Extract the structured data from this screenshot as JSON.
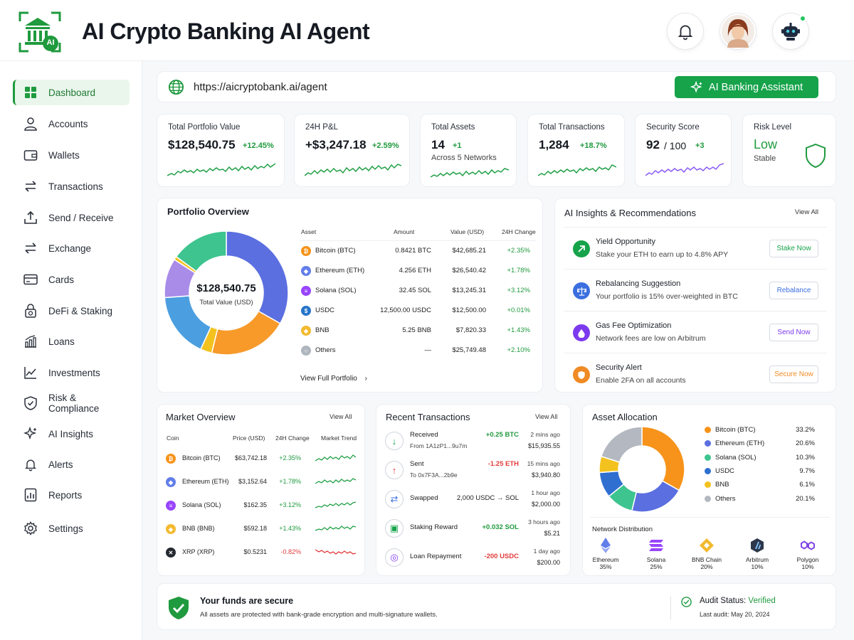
{
  "header": {
    "title": "AI Crypto Banking AI Agent",
    "logo_text": "AI",
    "bell_icon": "bell-icon",
    "avatar_icon": "user-avatar",
    "bot_icon": "robot-icon",
    "accent": "#16a34a"
  },
  "sidebar": {
    "items": [
      {
        "label": "Dashboard",
        "icon": "dashboard-icon",
        "active": true
      },
      {
        "label": "Accounts",
        "icon": "user-icon"
      },
      {
        "label": "Wallets",
        "icon": "wallet-icon"
      },
      {
        "label": "Transactions",
        "icon": "transfer-icon"
      },
      {
        "label": "Send / Receive",
        "icon": "upload-icon"
      },
      {
        "label": "Exchange",
        "icon": "exchange-icon"
      },
      {
        "label": "Cards",
        "icon": "card-icon"
      },
      {
        "label": "DeFi & Staking",
        "icon": "lock-coin-icon"
      },
      {
        "label": "Loans",
        "icon": "bar-chart-icon"
      },
      {
        "label": "Investments",
        "icon": "trend-icon"
      },
      {
        "label": "Risk & Compliance",
        "icon": "shield-icon"
      },
      {
        "label": "AI Insights",
        "icon": "sparkle-icon"
      },
      {
        "label": "Alerts",
        "icon": "bell-icon"
      },
      {
        "label": "Reports",
        "icon": "report-icon"
      },
      {
        "label": "Settings",
        "icon": "gear-icon"
      }
    ]
  },
  "urlbar": {
    "url": "https://aicryptobank.ai/agent",
    "assistant_label": "AI Banking Assistant"
  },
  "stats": {
    "portfolio": {
      "title": "Total Portfolio Value",
      "value": "$128,540.75",
      "change": "+12.45%"
    },
    "pnl": {
      "title": "24H P&L",
      "value": "+$3,247.18",
      "change": "+2.59%"
    },
    "assets": {
      "title": "Total Assets",
      "value": "14",
      "change": "+1",
      "sub": "Across 5 Networks"
    },
    "transactions": {
      "title": "Total Transactions",
      "value": "1,284",
      "change": "+18.7%"
    },
    "security": {
      "title": "Security Score",
      "value": "92",
      "outof": "/ 100",
      "change": "+3"
    },
    "risk": {
      "title": "Risk Level",
      "value": "Low",
      "sub": "Stable"
    }
  },
  "portfolio_overview": {
    "title": "Portfolio Overview",
    "center_value": "$128,540.75",
    "center_label": "Total Value (USD)",
    "headers": [
      "Asset",
      "Amount",
      "Value (USD)",
      "24H Change"
    ],
    "rows": [
      {
        "asset": "Bitcoin (BTC)",
        "amount": "0.8421 BTC",
        "value": "$42,685.21",
        "change": "+2.35%",
        "color": "#f7931a",
        "glyph": "₿"
      },
      {
        "asset": "Ethereum (ETH)",
        "amount": "4.256 ETH",
        "value": "$26,540.42",
        "change": "+1.78%",
        "color": "#627eea",
        "glyph": "◆"
      },
      {
        "asset": "Solana (SOL)",
        "amount": "32.45 SOL",
        "value": "$13,245.31",
        "change": "+3.12%",
        "color": "#9945ff",
        "glyph": "≡"
      },
      {
        "asset": "USDC",
        "amount": "12,500.00 USDC",
        "value": "$12,500.00",
        "change": "+0.01%",
        "color": "#2775ca",
        "glyph": "$"
      },
      {
        "asset": "BNB",
        "amount": "5.25 BNB",
        "value": "$7,820.33",
        "change": "+1.43%",
        "color": "#f3ba2f",
        "glyph": "◈"
      },
      {
        "asset": "Others",
        "amount": "—",
        "value": "$25,749.48",
        "change": "+2.10%",
        "color": "#b0b6bf",
        "glyph": "○"
      }
    ],
    "link": "View Full Portfolio"
  },
  "insights": {
    "title": "AI Insights & Recommendations",
    "view_all": "View All",
    "items": [
      {
        "title": "Yield Opportunity",
        "desc": "Stake your ETH to earn up to 4.8% APY",
        "button": "Stake Now",
        "color": "#16a34a",
        "icon": "trend-up-icon"
      },
      {
        "title": "Rebalancing Suggestion",
        "desc": "Your portfolio is 15% over-weighted in BTC",
        "button": "Rebalance",
        "color": "#3b6fe0",
        "icon": "scale-icon"
      },
      {
        "title": "Gas Fee Optimization",
        "desc": "Network fees are low on Arbitrum",
        "button": "Send Now",
        "color": "#7c3aed",
        "icon": "gas-icon"
      },
      {
        "title": "Security Alert",
        "desc": "Enable 2FA on all accounts",
        "button": "Secure Now",
        "color": "#f08a24",
        "icon": "shield-alert-icon"
      }
    ]
  },
  "market": {
    "title": "Market Overview",
    "view_all": "View All",
    "headers": [
      "Coin",
      "Price (USD)",
      "24H Change",
      "Market Trend"
    ],
    "rows": [
      {
        "coin": "Bitcoin (BTC)",
        "price": "$63,742.18",
        "change": "+2.35%",
        "color": "#f7931a",
        "glyph": "₿"
      },
      {
        "coin": "Ethereum (ETH)",
        "price": "$3,152.64",
        "change": "+1.78%",
        "color": "#627eea",
        "glyph": "◆"
      },
      {
        "coin": "Solana (SOL)",
        "price": "$162.35",
        "change": "+3.12%",
        "color": "#9945ff",
        "glyph": "≡"
      },
      {
        "coin": "BNB (BNB)",
        "price": "$592.18",
        "change": "+1.43%",
        "color": "#f3ba2f",
        "glyph": "◈"
      },
      {
        "coin": "XRP (XRP)",
        "price": "$0.5231",
        "change": "-0.82%",
        "color": "#23292f",
        "glyph": "✕"
      }
    ]
  },
  "recent_tx": {
    "title": "Recent Transactions",
    "view_all": "View All",
    "rows": [
      {
        "type": "Received",
        "sub": "From 1A1zP1...9u7m",
        "amount": "+0.25 BTC",
        "time": "2 mins ago",
        "usd": "$15,935.55",
        "kind": "pos",
        "glyph": "↓",
        "color": "#16a34a"
      },
      {
        "type": "Sent",
        "sub": "To 0x7F3A...2b9e",
        "amount": "-1.25 ETH",
        "time": "15 mins ago",
        "usd": "$3,940.80",
        "kind": "neg",
        "glyph": "↑",
        "color": "#e23b3b"
      },
      {
        "type": "Swapped",
        "sub": "",
        "amount": "2,000 USDC → SOL",
        "time": "1 hour ago",
        "usd": "$2,000.00",
        "kind": "neutral",
        "glyph": "⇄",
        "color": "#3b6fe0"
      },
      {
        "type": "Staking Reward",
        "sub": "",
        "amount": "+0.032 SOL",
        "time": "3 hours ago",
        "usd": "$5.21",
        "kind": "pos",
        "glyph": "▣",
        "color": "#16a34a"
      },
      {
        "type": "Loan Repayment",
        "sub": "",
        "amount": "-200 USDC",
        "time": "1 day ago",
        "usd": "$200.00",
        "kind": "neg",
        "glyph": "◎",
        "color": "#7c3aed"
      }
    ]
  },
  "allocation": {
    "title": "Asset Allocation",
    "items": [
      {
        "label": "Bitcoin (BTC)",
        "value": "33.2%",
        "pct": 33.2,
        "color": "#f7931a"
      },
      {
        "label": "Ethereum (ETH)",
        "value": "20.6%",
        "pct": 20.6,
        "color": "#5b6fe0"
      },
      {
        "label": "Solana (SOL)",
        "value": "10.3%",
        "pct": 10.3,
        "color": "#3ec48f"
      },
      {
        "label": "USDC",
        "value": "9.7%",
        "pct": 9.7,
        "color": "#2f6fd0"
      },
      {
        "label": "BNB",
        "value": "6.1%",
        "pct": 6.1,
        "color": "#f3c21f"
      },
      {
        "label": "Others",
        "value": "20.1%",
        "pct": 20.1,
        "color": "#b4b9c1"
      }
    ],
    "network_title": "Network Distribution",
    "networks": [
      {
        "name": "Ethereum",
        "pct": "35%",
        "icon": "ethereum-icon",
        "color": "#627eea"
      },
      {
        "name": "Solana",
        "pct": "25%",
        "icon": "solana-icon",
        "color": "#9945ff"
      },
      {
        "name": "BNB Chain",
        "pct": "20%",
        "icon": "bnb-icon",
        "color": "#f3ba2f"
      },
      {
        "name": "Arbitrum",
        "pct": "10%",
        "icon": "arbitrum-icon",
        "color": "#2d374b"
      },
      {
        "name": "Polygon",
        "pct": "10%",
        "icon": "polygon-icon",
        "color": "#8247e5"
      }
    ]
  },
  "portfolio_donut": [
    {
      "pct": 33.2,
      "color": "#5b6fe0"
    },
    {
      "pct": 20.6,
      "color": "#f79a2a"
    },
    {
      "pct": 3.0,
      "color": "#f3c21f"
    },
    {
      "pct": 17.0,
      "color": "#4b9fe0"
    },
    {
      "pct": 10.3,
      "color": "#a88ce8"
    },
    {
      "pct": 0.9,
      "color": "#f3c21f"
    },
    {
      "pct": 15.0,
      "color": "#3ec48f"
    }
  ],
  "footer": {
    "secure_title": "Your funds are secure",
    "secure_desc": "All assets are protected with bank-grade encryption and multi-signature wallets.",
    "audit_label": "Audit Status:",
    "audit_value": "Verified",
    "audit_date": "Last audit: May 20, 2024"
  }
}
